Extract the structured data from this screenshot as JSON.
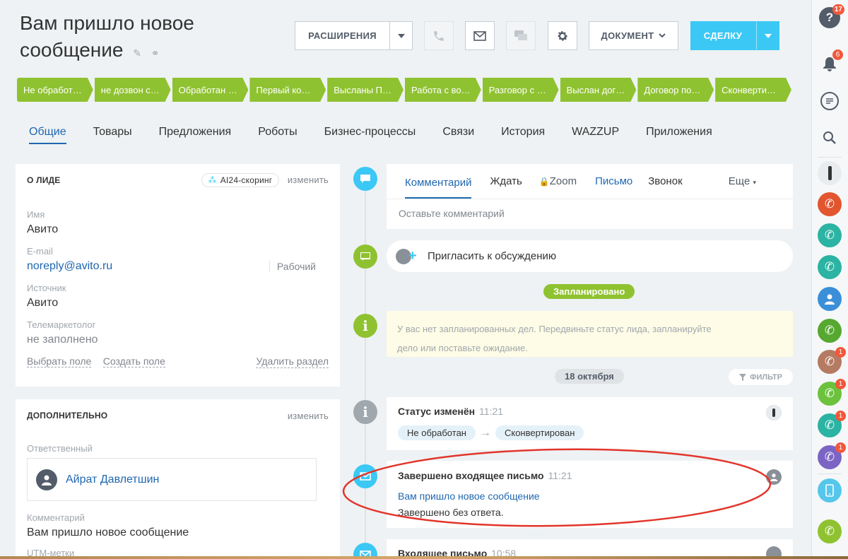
{
  "header": {
    "title": "Вам пришло новое сообщение",
    "edit_icon": "pencil-icon",
    "link_icon": "link-icon",
    "extensions_label": "РАСШИРЕНИЯ",
    "document_label": "ДОКУМЕНТ",
    "deal_label": "СДЕЛКУ"
  },
  "stages": [
    "Не обработ…",
    "не дозвон с…",
    "Обработан …",
    "Первый ко…",
    "Высланы П…",
    "Работа с во…",
    "Разговор с …",
    "Выслан дог…",
    "Договор по…",
    "Сконверти…"
  ],
  "tabs": [
    "Общие",
    "Товары",
    "Предложения",
    "Роботы",
    "Бизнес-процессы",
    "Связи",
    "История",
    "WAZZUP",
    "Приложения"
  ],
  "about": {
    "heading": "О ЛИДЕ",
    "scoring": "AI24-скоринг",
    "edit": "изменить",
    "name_label": "Имя",
    "name_value": "Авито",
    "email_label": "E-mail",
    "email_value": "noreply@avito.ru",
    "email_type": "Рабочий",
    "source_label": "Источник",
    "source_value": "Авито",
    "telemarketer_label": "Телемаркетолог",
    "telemarketer_value": "не заполнено",
    "choose_field": "Выбрать поле",
    "create_field": "Создать поле",
    "delete_section": "Удалить раздел"
  },
  "extra": {
    "heading": "ДОПОЛНИТЕЛЬНО",
    "edit": "изменить",
    "responsible_label": "Ответственный",
    "responsible_name": "Айрат Давлетшин",
    "comment_label": "Комментарий",
    "comment_value": "Вам пришло новое сообщение",
    "utm_label": "UTM-метки"
  },
  "composer": {
    "tabs": [
      "Комментарий",
      "Ждать",
      "Zoom",
      "Письмо",
      "Звонок"
    ],
    "more": "Еще",
    "placeholder": "Оставьте комментарий"
  },
  "invite": "Пригласить к обсуждению",
  "planned_label": "Запланировано",
  "planned_empty_line1": "У вас нет запланированных дел. Передвиньте статус лида, запланируйте",
  "planned_empty_line2": "дело или поставьте ожидание.",
  "date_label": "18 октября",
  "filter_label": "ФИЛЬТР",
  "status_event": {
    "title": "Статус изменён",
    "time": "11:21",
    "from": "Не обработан",
    "to": "Сконвертирован"
  },
  "mail_event": {
    "title": "Завершено входящее письмо",
    "time": "11:21",
    "subject": "Вам пришло новое сообщение",
    "result": "Завершено без ответа."
  },
  "mail_event2": {
    "title": "Входящее письмо",
    "time": "10:58"
  },
  "sidebar_badges": {
    "help": "17",
    "notifications": "6",
    "call1": "1",
    "call2": "1",
    "call3": "1",
    "call4": "1"
  },
  "colors": {
    "accent_blue": "#3bc8f5",
    "link_blue": "#2067b0",
    "stage_green": "#8fc230",
    "annotation_red": "#e2352b"
  }
}
